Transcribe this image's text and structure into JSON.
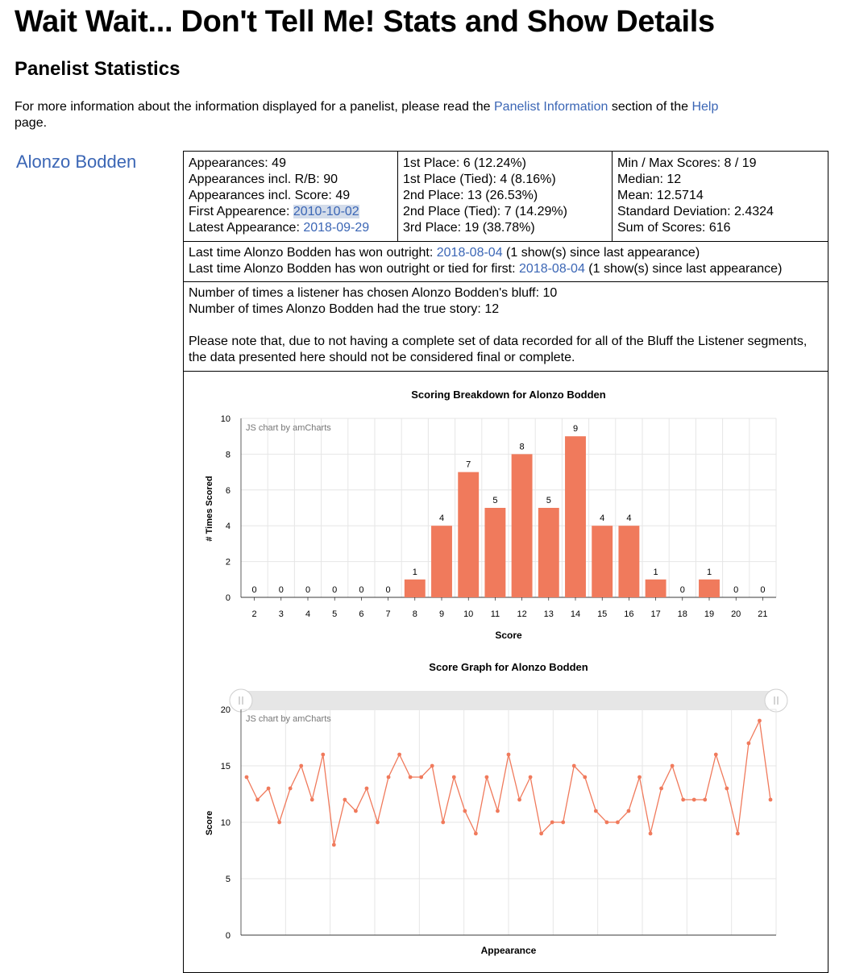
{
  "page": {
    "title": "Wait Wait... Don't Tell Me! Stats and Show Details",
    "section_title": "Panelist Statistics",
    "intro_prefix": "For more information about the information displayed for a panelist, please read the ",
    "intro_link1": "Panelist Information",
    "intro_mid": " section of the ",
    "intro_link2": "Help",
    "intro_suffix": " page."
  },
  "panelist": {
    "name": "Alonzo Bodden",
    "appearances": "Appearances: 49",
    "appearances_rb": "Appearances incl. R/B: 90",
    "appearances_score": "Appearances incl. Score: 49",
    "first_label": "First Appearence: ",
    "first_date": "2010-10-02",
    "latest_label": "Latest Appearance: ",
    "latest_date": "2018-09-29",
    "place1": "1st Place: 6 (12.24%)",
    "place1_tied": "1st Place (Tied): 4 (8.16%)",
    "place2": "2nd Place: 13 (26.53%)",
    "place2_tied": "2nd Place (Tied): 7 (14.29%)",
    "place3": "3rd Place: 19 (38.78%)",
    "minmax": "Min / Max Scores: 8 / 19",
    "median": "Median: 12",
    "mean": "Mean: 12.5714",
    "stddev": "Standard Deviation: 2.4324",
    "sum": "Sum of Scores: 616",
    "outright_prefix": "Last time Alonzo Bodden has won outright: ",
    "outright_date": "2018-08-04",
    "outright_suffix": " (1 show(s) since last appearance)",
    "tied_prefix": "Last time Alonzo Bodden has won outright or tied for first: ",
    "tied_date": "2018-08-04",
    "tied_suffix": " (1 show(s) since last appearance)",
    "bluff_chosen": "Number of times a listener has chosen Alonzo Bodden's bluff: 10",
    "true_story": "Number of times Alonzo Bodden had the true story: 12",
    "bluff_note": "Please note that, due to not having a complete set of data recorded for all of the Bluff the Listener segments, the data presented here should not be considered final or complete."
  },
  "chart_credit": "JS chart by amCharts",
  "chart_data": [
    {
      "type": "bar",
      "title": "Scoring Breakdown for Alonzo Bodden",
      "xlabel": "Score",
      "ylabel": "# Times Scored",
      "categories": [
        "2",
        "3",
        "4",
        "5",
        "6",
        "7",
        "8",
        "9",
        "10",
        "11",
        "12",
        "13",
        "14",
        "15",
        "16",
        "17",
        "18",
        "19",
        "20",
        "21"
      ],
      "values": [
        0,
        0,
        0,
        0,
        0,
        0,
        1,
        4,
        7,
        5,
        8,
        5,
        9,
        4,
        4,
        1,
        0,
        1,
        0,
        0
      ],
      "ylim": [
        0,
        10
      ],
      "yticks": [
        0,
        2,
        4,
        6,
        8,
        10
      ],
      "color": "#f07a5c",
      "grid": true
    },
    {
      "type": "line",
      "title": "Score Graph for Alonzo Bodden",
      "xlabel": "Appearance",
      "ylabel": "Score",
      "values": [
        14,
        12,
        13,
        10,
        13,
        15,
        12,
        16,
        8,
        12,
        11,
        13,
        10,
        14,
        16,
        14,
        14,
        15,
        10,
        14,
        11,
        9,
        14,
        11,
        16,
        12,
        14,
        9,
        10,
        10,
        15,
        14,
        11,
        10,
        10,
        11,
        14,
        9,
        13,
        15,
        12,
        12,
        12,
        16,
        13,
        9,
        17,
        19,
        12
      ],
      "ylim": [
        0,
        20
      ],
      "yticks": [
        0,
        5,
        10,
        15,
        20
      ],
      "color": "#f07a5c",
      "grid": true,
      "scrollbar": true
    }
  ]
}
